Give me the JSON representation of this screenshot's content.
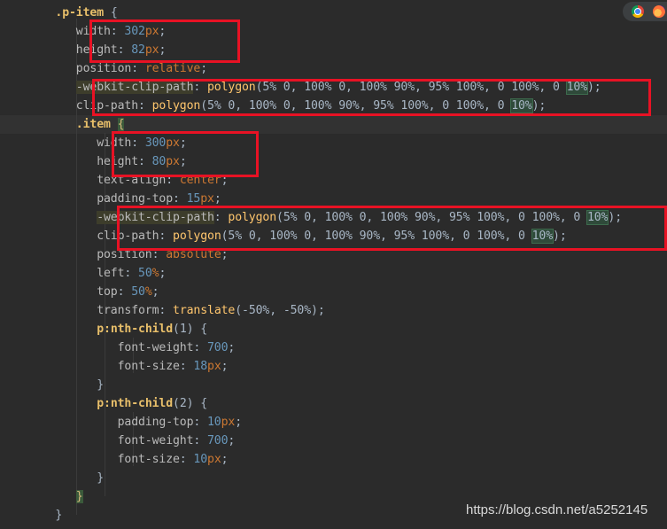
{
  "browsers": {
    "chrome_icon": "chrome-icon",
    "firefox_icon": "firefox-icon"
  },
  "watermark": "https://blog.csdn.net/a5252145",
  "colors": {
    "background": "#2b2b2b",
    "selector": "#e8bf6a",
    "number": "#6897bb",
    "keyword": "#cc7832",
    "function": "#ffc66d",
    "annotation": "#e81224"
  },
  "code": {
    "l1_sel": ".p-item",
    "l1_brace": " {",
    "width_outer": {
      "prop": "width",
      "num": "302",
      "unit": "px"
    },
    "height_outer": {
      "prop": "height",
      "num": "82",
      "unit": "px"
    },
    "position_outer": {
      "prop": "position",
      "val": "relative"
    },
    "clip_webkit_outer": {
      "prop": "-webkit-clip-path",
      "fn": "polygon",
      "args": "(5% 0, 100% 0, 100% 90%, 95% 100%, 0 100%, 0 ",
      "last": "10%",
      "end": ");"
    },
    "clip_outer": {
      "prop": "clip-path",
      "fn": "polygon",
      "args": "(5% 0, 100% 0, 100% 90%, 95% 100%, 0 100%, 0 ",
      "last": "10%",
      "end": ");"
    },
    "item_sel": ".item",
    "item_brace": "{",
    "width_inner": {
      "prop": "width",
      "num": "300",
      "unit": "px"
    },
    "height_inner": {
      "prop": "height",
      "num": "80",
      "unit": "px"
    },
    "text_align": {
      "prop": "text-align",
      "val": "center"
    },
    "padding_top": {
      "prop": "padding-top",
      "num": "15",
      "unit": "px"
    },
    "clip_webkit_inner": {
      "prop": "-webkit-clip-path",
      "fn": "polygon",
      "args": "(5% 0, 100% 0, 100% 90%, 95% 100%, 0 100%, 0 ",
      "last": "10%",
      "end": ");"
    },
    "clip_inner": {
      "prop": "clip-path",
      "fn": "polygon",
      "args": "(5% 0, 100% 0, 100% 90%, 95% 100%, 0 100%, 0 ",
      "last": "10%",
      "end": ");"
    },
    "position_inner": {
      "prop": "position",
      "val": "absolute"
    },
    "left": {
      "prop": "left",
      "num": "50",
      "unit": "%"
    },
    "top": {
      "prop": "top",
      "num": "50",
      "unit": "%"
    },
    "transform": {
      "prop": "transform",
      "fn": "translate",
      "args": "(-50%, -50%)",
      "end": ";"
    },
    "p_nth1": {
      "tag": "p",
      "pseudo": ":nth-child",
      "arg": "(1)",
      "brace": " {"
    },
    "fw1": {
      "prop": "font-weight",
      "num": "700"
    },
    "fs1": {
      "prop": "font-size",
      "num": "18",
      "unit": "px"
    },
    "close1": "}",
    "p_nth2": {
      "tag": "p",
      "pseudo": ":nth-child",
      "arg": "(2)",
      "brace": " {"
    },
    "pt2": {
      "prop": "padding-top",
      "num": "10",
      "unit": "px"
    },
    "fw2": {
      "prop": "font-weight",
      "num": "700"
    },
    "fs2": {
      "prop": "font-size",
      "num": "10",
      "unit": "px"
    },
    "close2": "}",
    "close_item": "}",
    "close_outer": "}"
  }
}
